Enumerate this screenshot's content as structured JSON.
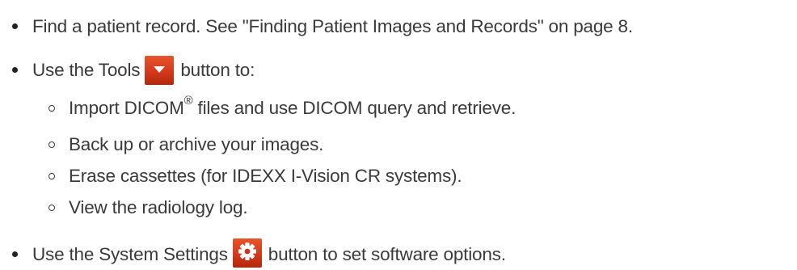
{
  "bullets": [
    {
      "text": "Find a patient record. See \"Finding Patient Images and Records\" on page 8."
    },
    {
      "before_icon": "Use the Tools",
      "icon": "chevron-down-icon",
      "after_icon": "button to:",
      "sub_items": [
        {
          "before": "Import DICOM",
          "sup": "®",
          "after": " files and use DICOM query and retrieve."
        },
        {
          "text": "Back up or archive your images."
        },
        {
          "text": "Erase cassettes (for IDEXX I-Vision CR systems)."
        },
        {
          "text": "View the radiology log."
        }
      ]
    },
    {
      "before_icon": "Use the System Settings",
      "icon": "gear-icon",
      "after_icon": "button to set software options."
    }
  ],
  "colors": {
    "text": "#3a3a3a",
    "icon_bg": "#d23a1b",
    "icon_glyph": "#ffffff"
  }
}
